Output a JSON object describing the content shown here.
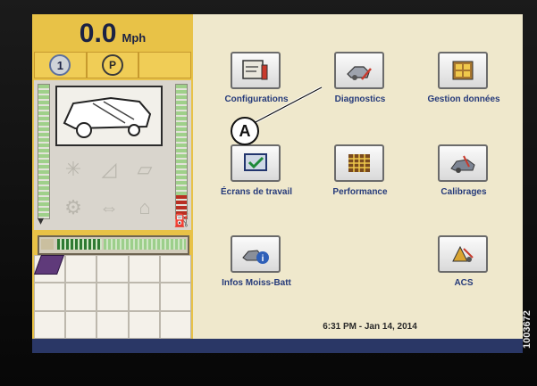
{
  "status": {
    "speed_value": "0.0",
    "speed_unit": "Mph",
    "gear": "1",
    "park": "P"
  },
  "fill_level": 0.35,
  "menu": [
    {
      "label": "Configurations",
      "icon": "configurations-icon"
    },
    {
      "label": "Diagnostics",
      "icon": "diagnostics-icon"
    },
    {
      "label": "Gestion données",
      "icon": "data-management-icon"
    },
    {
      "label": "Écrans de travail",
      "icon": "work-screens-icon"
    },
    {
      "label": "Performance",
      "icon": "performance-icon"
    },
    {
      "label": "Calibrages",
      "icon": "calibrations-icon"
    },
    {
      "label": "Infos Moiss-Batt",
      "icon": "combine-info-icon"
    },
    {
      "label": "ACS",
      "icon": "acs-icon"
    }
  ],
  "clock": "6:31 PM - Jan 14, 2014",
  "callout": "A",
  "doc_number": "1003672",
  "colors": {
    "panel_yellow": "#e8c247",
    "menu_bg": "#efe8cc",
    "label_blue": "#253a7a",
    "footer_navy": "#2a3766"
  }
}
